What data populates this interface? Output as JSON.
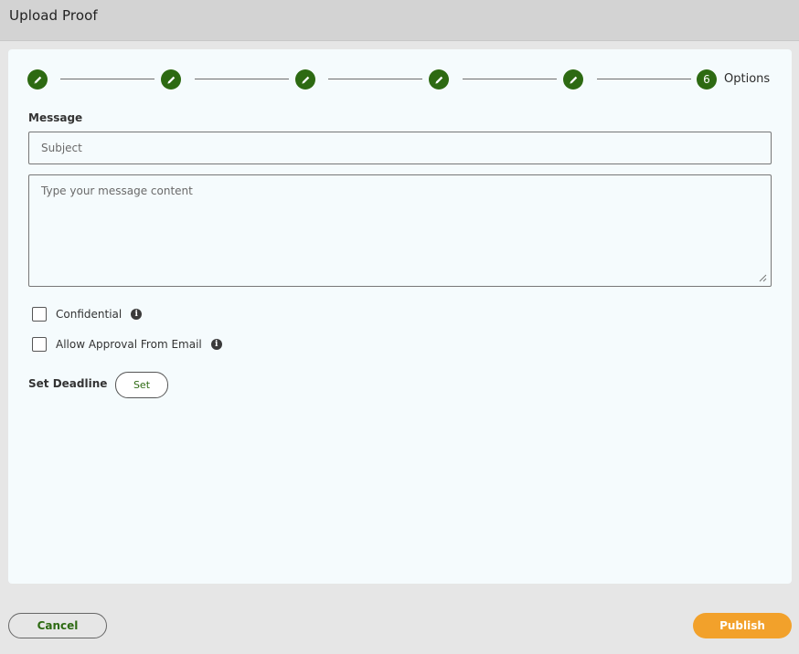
{
  "window": {
    "title": "Upload Proof"
  },
  "stepper": {
    "current_step_number": "6",
    "current_step_label": "Options",
    "completed_step_icon": "pencil-icon",
    "accent_color": "#2d6a12"
  },
  "message": {
    "label": "Message",
    "subject_placeholder": "Subject",
    "subject_value": "",
    "content_placeholder": "Type your message content",
    "content_value": ""
  },
  "options": {
    "confidential_label": "Confidential",
    "confidential_checked": false,
    "allow_approval_label": "Allow Approval From Email",
    "allow_approval_checked": false,
    "info_icon": "info-icon"
  },
  "deadline": {
    "label": "Set Deadline",
    "set_label": "Set"
  },
  "footer": {
    "cancel_label": "Cancel",
    "publish_label": "Publish",
    "publish_color": "#f2a12b"
  }
}
